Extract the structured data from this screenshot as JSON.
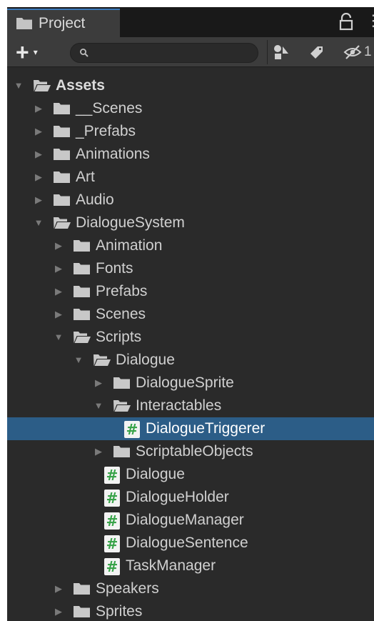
{
  "tab": {
    "label": "Project",
    "icon": "folder-icon"
  },
  "window_controls": {
    "lock_icon": "lock-icon",
    "more_label": "⋮"
  },
  "toolbar": {
    "add_label": "+",
    "add_caret": "▾",
    "search_value": "",
    "search_icon": "search-icon",
    "filter_type_icon": "filter-by-type-icon",
    "filter_label_icon": "filter-by-label-icon",
    "hidden_packages_icon": "eye-slash-icon",
    "hidden_count": "1"
  },
  "colors": {
    "background": "#2a2a2a",
    "selection": "#2c5d87",
    "script_hash": "#38a349",
    "tab_accent": "#3a79bb"
  },
  "tree": [
    {
      "name": "Assets",
      "type": "folder",
      "depth": 0,
      "expanded": true,
      "bold": true
    },
    {
      "name": "__Scenes",
      "type": "folder",
      "depth": 1,
      "expanded": false
    },
    {
      "name": "_Prefabs",
      "type": "folder",
      "depth": 1,
      "expanded": false
    },
    {
      "name": "Animations",
      "type": "folder",
      "depth": 1,
      "expanded": false
    },
    {
      "name": "Art",
      "type": "folder",
      "depth": 1,
      "expanded": false
    },
    {
      "name": "Audio",
      "type": "folder",
      "depth": 1,
      "expanded": false
    },
    {
      "name": "DialogueSystem",
      "type": "folder",
      "depth": 1,
      "expanded": true
    },
    {
      "name": "Animation",
      "type": "folder",
      "depth": 2,
      "expanded": false
    },
    {
      "name": "Fonts",
      "type": "folder",
      "depth": 2,
      "expanded": false
    },
    {
      "name": "Prefabs",
      "type": "folder",
      "depth": 2,
      "expanded": false
    },
    {
      "name": "Scenes",
      "type": "folder",
      "depth": 2,
      "expanded": false
    },
    {
      "name": "Scripts",
      "type": "folder",
      "depth": 2,
      "expanded": true
    },
    {
      "name": "Dialogue",
      "type": "folder",
      "depth": 3,
      "expanded": true
    },
    {
      "name": "DialogueSprite",
      "type": "folder",
      "depth": 4,
      "expanded": false
    },
    {
      "name": "Interactables",
      "type": "folder",
      "depth": 4,
      "expanded": true
    },
    {
      "name": "DialogueTriggerer",
      "type": "script",
      "depth": 5,
      "selected": true
    },
    {
      "name": "ScriptableObjects",
      "type": "folder",
      "depth": 4,
      "expanded": false
    },
    {
      "name": "Dialogue",
      "type": "script",
      "depth": 4
    },
    {
      "name": "DialogueHolder",
      "type": "script",
      "depth": 4
    },
    {
      "name": "DialogueManager",
      "type": "script",
      "depth": 4
    },
    {
      "name": "DialogueSentence",
      "type": "script",
      "depth": 4
    },
    {
      "name": "TaskManager",
      "type": "script",
      "depth": 4
    },
    {
      "name": "Speakers",
      "type": "folder",
      "depth": 2,
      "expanded": false
    },
    {
      "name": "Sprites",
      "type": "folder",
      "depth": 2,
      "expanded": false
    }
  ]
}
